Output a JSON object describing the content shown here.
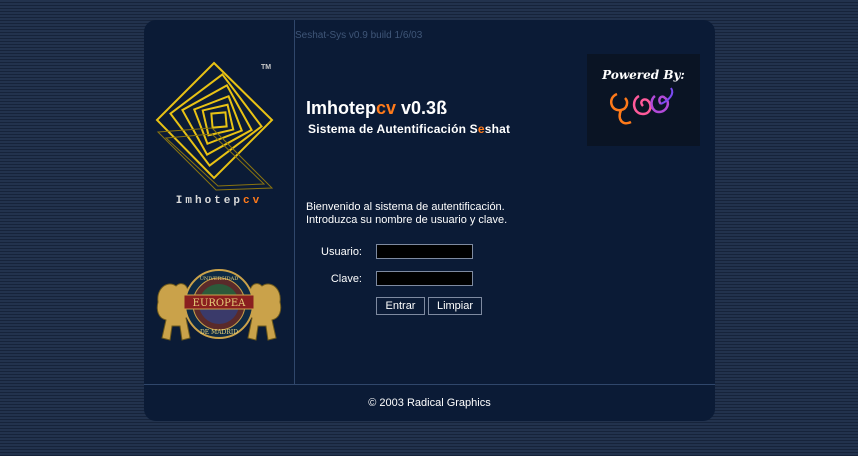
{
  "app": {
    "build": "Seshat-Sys v0.9 build 1/6/03",
    "title_main": "Imhotep",
    "title_cv": "cv",
    "title_version": " v0.3ß",
    "subtitle_pre": "Sistema de Autentificación ",
    "subtitle_s": "S",
    "subtitle_e": "e",
    "subtitle_post": "shat"
  },
  "logo": {
    "text": "Imhotep",
    "text_cv": "cv",
    "tm": "TM",
    "color": "#e8c214"
  },
  "seal": {
    "ring_top": "UNIVERSIDAD",
    "band": "EUROPEA",
    "ring_bottom": "DE MADRID"
  },
  "powered": {
    "text": "Powered By:"
  },
  "login": {
    "welcome_line1": "Bienvenido al sistema de autentificación.",
    "welcome_line2": "Introduzca su nombre de usuario y clave.",
    "user_label": "Usuario:",
    "user_value": "",
    "pass_label": "Clave:",
    "pass_value": "",
    "submit_label": "Entrar",
    "clear_label": "Limpiar"
  },
  "footer": {
    "text": "© 2003 Radical Graphics"
  },
  "colors": {
    "accent": "#ff7a1a",
    "panel": "#0b1b36",
    "logo_gold": "#e8c214"
  }
}
